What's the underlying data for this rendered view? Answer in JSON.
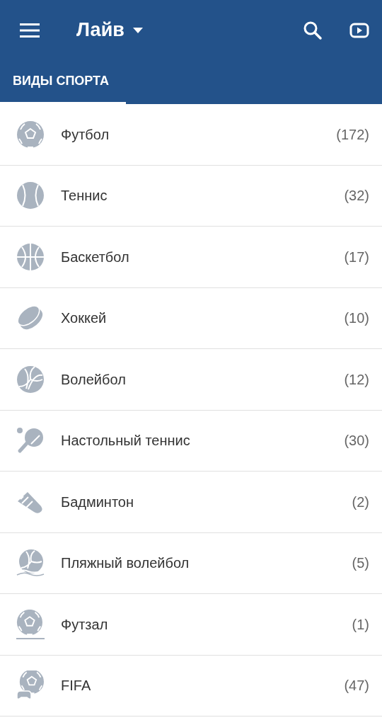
{
  "app_bar": {
    "title": "Лайв"
  },
  "tabs": [
    {
      "label": "ВИДЫ СПОРТА",
      "selected": true
    }
  ],
  "sports": [
    {
      "kind": "soccer",
      "name": "Футбол",
      "count": "(172)"
    },
    {
      "kind": "tennis",
      "name": "Теннис",
      "count": "(32)"
    },
    {
      "kind": "basketball",
      "name": "Баскетбол",
      "count": "(17)"
    },
    {
      "kind": "hockey",
      "name": "Хоккей",
      "count": "(10)"
    },
    {
      "kind": "volleyball",
      "name": "Волейбол",
      "count": "(12)"
    },
    {
      "kind": "tabletennis",
      "name": "Настольный теннис",
      "count": "(30)"
    },
    {
      "kind": "badminton",
      "name": "Бадминтон",
      "count": "(2)"
    },
    {
      "kind": "beachvolleyball",
      "name": "Пляжный волейбол",
      "count": "(5)"
    },
    {
      "kind": "futsal",
      "name": "Футзал",
      "count": "(1)"
    },
    {
      "kind": "esports",
      "name": "FIFA",
      "count": "(47)"
    }
  ]
}
